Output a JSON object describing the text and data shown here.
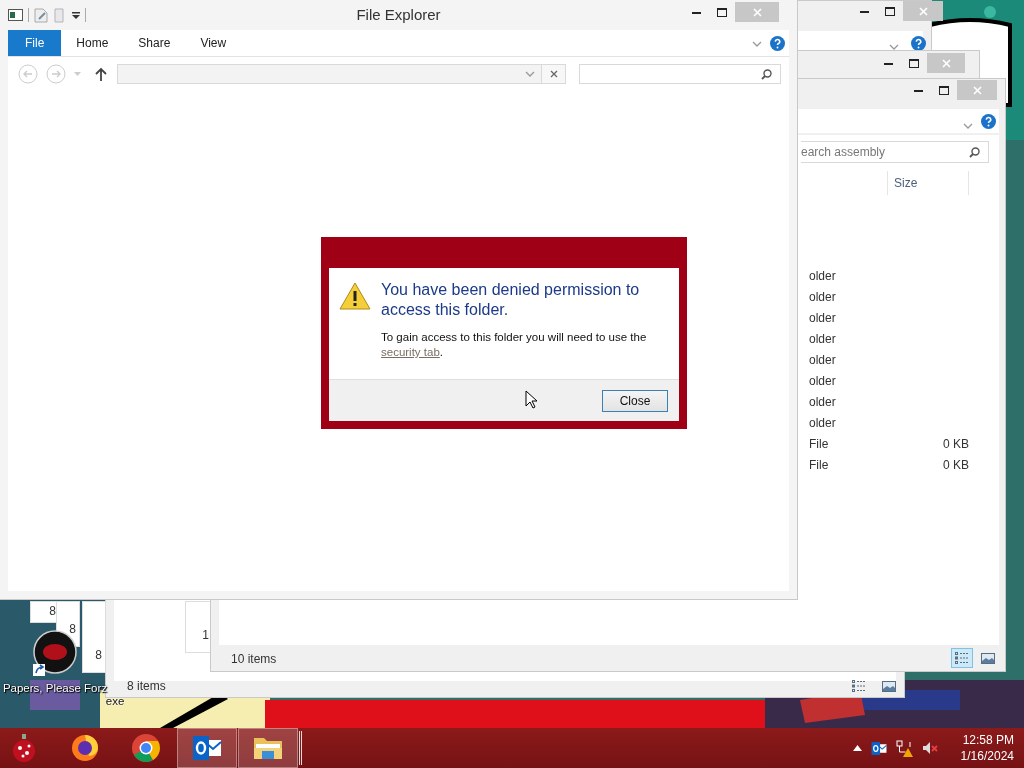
{
  "main_window": {
    "title": "File Explorer",
    "ribbon_tabs": [
      {
        "label": "File",
        "selected": true
      },
      {
        "label": "Home",
        "selected": false
      },
      {
        "label": "Share",
        "selected": false
      },
      {
        "label": "View",
        "selected": false
      }
    ]
  },
  "assembly_window": {
    "search_placeholder": "earch assembly",
    "columns": [
      "Size"
    ],
    "rows": [
      {
        "type": "older"
      },
      {
        "type": "older"
      },
      {
        "type": "older"
      },
      {
        "type": "older"
      },
      {
        "type": "older"
      },
      {
        "type": "older"
      },
      {
        "type": "older"
      },
      {
        "type": "older"
      },
      {
        "type": "File",
        "size": "0 KB"
      },
      {
        "type": "File",
        "size": "0 KB"
      }
    ],
    "status": "10 items",
    "views": [
      {
        "kind": "details",
        "selected": true
      },
      {
        "kind": "tiles",
        "selected": false
      }
    ]
  },
  "lower_window": {
    "status": "8 items",
    "views": [
      {
        "kind": "details",
        "selected": false
      },
      {
        "kind": "tiles",
        "selected": false
      }
    ]
  },
  "cascade_windows": [
    {
      "status": "8"
    },
    {
      "status": "8"
    },
    {
      "status": "8"
    },
    {
      "status": "1"
    }
  ],
  "desktop_icon": {
    "label": "Papers, Please Forz",
    "label_line_2": "exe"
  },
  "dialog": {
    "heading": "You have been denied permission to access this folder.",
    "body": "To gain access to this folder you will need to use the",
    "link": "security tab",
    "body_end": ".",
    "button": "Close"
  },
  "taskbar": {
    "apps": [
      {
        "kind": "ornament",
        "selected": false
      },
      {
        "kind": "firefox",
        "selected": false
      },
      {
        "kind": "chrome",
        "selected": false
      },
      {
        "kind": "outlook",
        "selected": true
      },
      {
        "kind": "explorer",
        "selected": true
      }
    ],
    "tray": {
      "muted": true
    },
    "time": "12:58 PM",
    "date": "1/16/2024"
  }
}
